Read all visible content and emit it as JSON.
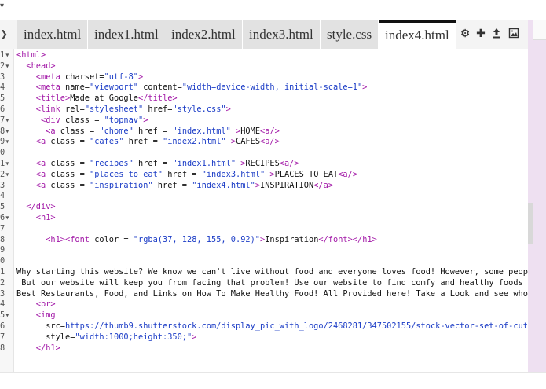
{
  "editor": {
    "tabs": [
      {
        "label": "index.html",
        "active": false
      },
      {
        "label": "index1.html",
        "active": false
      },
      {
        "label": "index2.html",
        "active": false
      },
      {
        "label": "index3.html",
        "active": false
      },
      {
        "label": "style.css",
        "active": false
      },
      {
        "label": "index4.html",
        "active": true
      }
    ],
    "toolbar_icons": [
      "gear-icon",
      "plus-icon",
      "upload-icon",
      "image-icon"
    ]
  },
  "code_lines": [
    {
      "n": "1",
      "fold": true,
      "segs": [
        {
          "t": "<html>",
          "c": "tg"
        }
      ]
    },
    {
      "n": "2",
      "fold": true,
      "segs": [
        {
          "t": "  <head>",
          "c": "tg"
        }
      ]
    },
    {
      "n": "3",
      "fold": false,
      "segs": [
        {
          "t": "    <meta ",
          "c": "tg"
        },
        {
          "t": "charset=",
          "c": "at"
        },
        {
          "t": "\"utf-8\"",
          "c": "st"
        },
        {
          "t": ">",
          "c": "tg"
        }
      ]
    },
    {
      "n": "4",
      "fold": false,
      "segs": [
        {
          "t": "    <meta ",
          "c": "tg"
        },
        {
          "t": "name=",
          "c": "at"
        },
        {
          "t": "\"viewport\"",
          "c": "st"
        },
        {
          "t": " content=",
          "c": "at"
        },
        {
          "t": "\"width=device-width, initial-scale=1\"",
          "c": "st"
        },
        {
          "t": ">",
          "c": "tg"
        }
      ]
    },
    {
      "n": "5",
      "fold": false,
      "segs": [
        {
          "t": "    <title>",
          "c": "tg"
        },
        {
          "t": "Made at Google",
          "c": "at"
        },
        {
          "t": "</title>",
          "c": "tg"
        }
      ]
    },
    {
      "n": "6",
      "fold": false,
      "segs": [
        {
          "t": "    <link ",
          "c": "tg"
        },
        {
          "t": "rel=",
          "c": "at"
        },
        {
          "t": "\"stylesheet\"",
          "c": "st"
        },
        {
          "t": " href=",
          "c": "at"
        },
        {
          "t": "\"style.css\"",
          "c": "st"
        },
        {
          "t": ">",
          "c": "tg"
        }
      ]
    },
    {
      "n": "7",
      "fold": true,
      "segs": [
        {
          "t": "     <div ",
          "c": "tg"
        },
        {
          "t": "class = ",
          "c": "at"
        },
        {
          "t": "\"topnav\"",
          "c": "st"
        },
        {
          "t": ">",
          "c": "tg"
        }
      ]
    },
    {
      "n": "8",
      "fold": true,
      "segs": [
        {
          "t": "      <a ",
          "c": "tg"
        },
        {
          "t": "class = ",
          "c": "at"
        },
        {
          "t": "\"chome\"",
          "c": "st"
        },
        {
          "t": " href = ",
          "c": "at"
        },
        {
          "t": "\"index.html\"",
          "c": "st"
        },
        {
          "t": " >",
          "c": "tg"
        },
        {
          "t": "HOME",
          "c": "at"
        },
        {
          "t": "<a/>",
          "c": "tg"
        }
      ]
    },
    {
      "n": "9",
      "fold": true,
      "segs": [
        {
          "t": "    <a ",
          "c": "tg"
        },
        {
          "t": "class = ",
          "c": "at"
        },
        {
          "t": "\"cafes\"",
          "c": "st"
        },
        {
          "t": " href = ",
          "c": "at"
        },
        {
          "t": "\"index2.html\"",
          "c": "st"
        },
        {
          "t": " >",
          "c": "tg"
        },
        {
          "t": "CAFES",
          "c": "at"
        },
        {
          "t": "<a/>",
          "c": "tg"
        }
      ]
    },
    {
      "n": "0",
      "fold": false,
      "segs": []
    },
    {
      "n": "1",
      "fold": true,
      "segs": [
        {
          "t": "    <a ",
          "c": "tg"
        },
        {
          "t": "class = ",
          "c": "at"
        },
        {
          "t": "\"recipes\"",
          "c": "st"
        },
        {
          "t": " href = ",
          "c": "at"
        },
        {
          "t": "\"index1.html\"",
          "c": "st"
        },
        {
          "t": " >",
          "c": "tg"
        },
        {
          "t": "RECIPES",
          "c": "at"
        },
        {
          "t": "<a/>",
          "c": "tg"
        }
      ]
    },
    {
      "n": "2",
      "fold": true,
      "segs": [
        {
          "t": "    <a ",
          "c": "tg"
        },
        {
          "t": "class = ",
          "c": "at"
        },
        {
          "t": "\"places to eat\"",
          "c": "st"
        },
        {
          "t": " href = ",
          "c": "at"
        },
        {
          "t": "\"index3.html\"",
          "c": "st"
        },
        {
          "t": " >",
          "c": "tg"
        },
        {
          "t": "PLACES TO EAT",
          "c": "at"
        },
        {
          "t": "<a/>",
          "c": "tg"
        }
      ]
    },
    {
      "n": "3",
      "fold": false,
      "segs": [
        {
          "t": "    <a ",
          "c": "tg"
        },
        {
          "t": "class = ",
          "c": "at"
        },
        {
          "t": "\"inspiration\"",
          "c": "st"
        },
        {
          "t": " href = ",
          "c": "at"
        },
        {
          "t": "\"index4.html\"",
          "c": "st"
        },
        {
          "t": ">",
          "c": "tg"
        },
        {
          "t": "INSPIRATION",
          "c": "at"
        },
        {
          "t": "</a>",
          "c": "tg"
        }
      ]
    },
    {
      "n": "4",
      "fold": false,
      "segs": []
    },
    {
      "n": "5",
      "fold": false,
      "segs": [
        {
          "t": "  </div>",
          "c": "tg"
        }
      ]
    },
    {
      "n": "6",
      "fold": true,
      "segs": [
        {
          "t": "    <h1>",
          "c": "tg"
        }
      ]
    },
    {
      "n": "7",
      "fold": false,
      "segs": []
    },
    {
      "n": "8",
      "fold": false,
      "segs": [
        {
          "t": "      <h1><font ",
          "c": "tg"
        },
        {
          "t": "color = ",
          "c": "at"
        },
        {
          "t": "\"rgba(37, 128, 155, 0.92)\"",
          "c": "st"
        },
        {
          "t": ">",
          "c": "tg"
        },
        {
          "t": "Inspiration",
          "c": "at"
        },
        {
          "t": "</font></h1>",
          "c": "tg"
        }
      ]
    },
    {
      "n": "9",
      "fold": false,
      "segs": []
    },
    {
      "n": "0",
      "fold": false,
      "segs": []
    },
    {
      "n": "1",
      "fold": false,
      "segs": [
        {
          "t": "Why starting this website? We know we can't live without food and everyone loves food! However, some peop",
          "c": "at"
        }
      ]
    },
    {
      "n": "2",
      "fold": false,
      "segs": [
        {
          "t": " But our website will keep you from facing that problem! Use our website to find comfy and healthy foods",
          "c": "at"
        }
      ]
    },
    {
      "n": "3",
      "fold": false,
      "segs": [
        {
          "t": "Best Restaurants, Food, and Links on How To Make Healthy Food! All Provided here! Take a Look and see who",
          "c": "at"
        }
      ]
    },
    {
      "n": "4",
      "fold": false,
      "segs": [
        {
          "t": "    <br>",
          "c": "tg"
        }
      ]
    },
    {
      "n": "5",
      "fold": true,
      "segs": [
        {
          "t": "    <img",
          "c": "tg"
        }
      ]
    },
    {
      "n": "6",
      "fold": false,
      "segs": [
        {
          "t": "      src=",
          "c": "at"
        },
        {
          "t": "https://thumb9.shutterstock.com/display_pic_with_logo/2468281/347502155/stock-vector-set-of-cut",
          "c": "st"
        }
      ]
    },
    {
      "n": "7",
      "fold": false,
      "segs": [
        {
          "t": "      style=",
          "c": "at"
        },
        {
          "t": "\"width:1000;height:350;\"",
          "c": "st"
        },
        {
          "t": ">",
          "c": "tg"
        }
      ]
    },
    {
      "n": "8",
      "fold": false,
      "segs": [
        {
          "t": "    </h1>",
          "c": "tg"
        }
      ]
    }
  ]
}
